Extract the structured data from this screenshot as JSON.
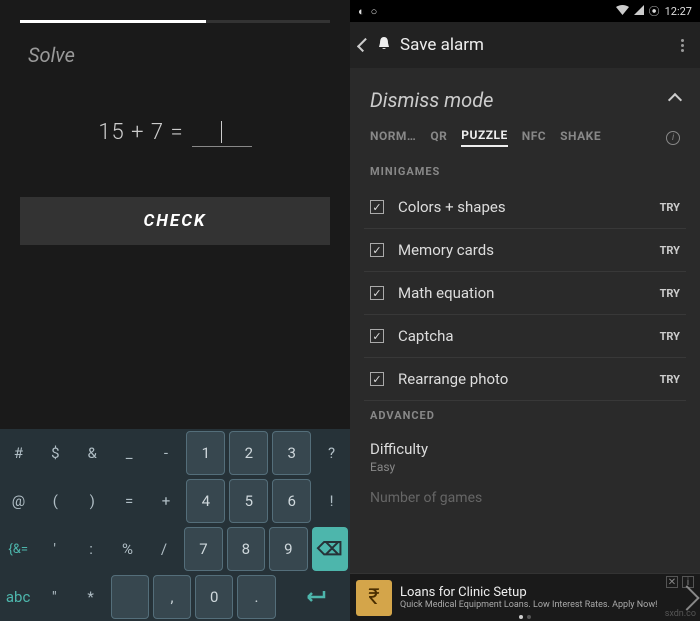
{
  "left": {
    "title": "Solve",
    "equation": "15 + 7 =",
    "answer": "",
    "check_label": "CHECK",
    "keyboard": {
      "rows": [
        [
          "#",
          "$",
          "&",
          "_",
          "-",
          "1",
          "2",
          "3",
          "?"
        ],
        [
          "@",
          "(",
          ")",
          "=",
          "+",
          "4",
          "5",
          "6",
          "!"
        ],
        [
          "{&=",
          "'",
          ":",
          "%",
          "/",
          "7",
          "8",
          "9",
          "⌫"
        ],
        [
          "abc",
          "\"",
          "*",
          "",
          ",",
          "0",
          ".",
          "↵"
        ]
      ]
    }
  },
  "right": {
    "status": {
      "time": "12:27",
      "icons": [
        "podcast",
        "circle",
        "wifi",
        "signal",
        "settings"
      ]
    },
    "toolbar": {
      "title": "Save alarm"
    },
    "section": {
      "title": "Dismiss mode"
    },
    "tabs": [
      "NORM…",
      "QR",
      "PUZZLE",
      "NFC",
      "SHAKE"
    ],
    "active_tab": "PUZZLE",
    "minigames_label": "MINIGAMES",
    "minigames": [
      {
        "label": "Colors + shapes",
        "checked": true
      },
      {
        "label": "Memory cards",
        "checked": true
      },
      {
        "label": "Math equation",
        "checked": true
      },
      {
        "label": "Captcha",
        "checked": true
      },
      {
        "label": "Rearrange photo",
        "checked": true
      }
    ],
    "try_label": "TRY",
    "advanced_label": "ADVANCED",
    "difficulty": {
      "title": "Difficulty",
      "value": "Easy"
    },
    "faded": "Number of games"
  },
  "ad": {
    "title": "Loans for Clinic Setup",
    "sub": "Quick Medical Equipment Loans. Low Interest Rates. Apply Now!",
    "icon_glyph": "₹"
  },
  "watermark": "sxdn.co"
}
